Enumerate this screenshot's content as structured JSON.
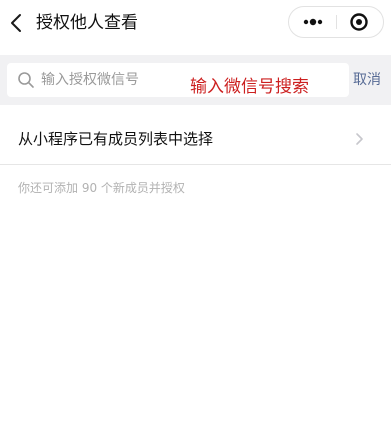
{
  "nav": {
    "back_icon": "chevron-left-icon",
    "title": "授权他人查看",
    "more_icon": "more-dots-icon",
    "close_icon": "target-close-icon"
  },
  "search": {
    "icon": "search-icon",
    "placeholder": "输入授权微信号",
    "value": "",
    "cancel_label": "取消",
    "overlay_annotation": "输入微信号搜索"
  },
  "member_select": {
    "label": "从小程序已有成员列表中选择",
    "chevron_icon": "chevron-right-icon"
  },
  "quota_hint": "你还可添加 90 个新成员并授权",
  "colors": {
    "link_blue": "#576b95",
    "annotation_red": "#cc1f1f",
    "band_gray": "#f1f1f3",
    "hint_gray": "#b2b2b2"
  }
}
